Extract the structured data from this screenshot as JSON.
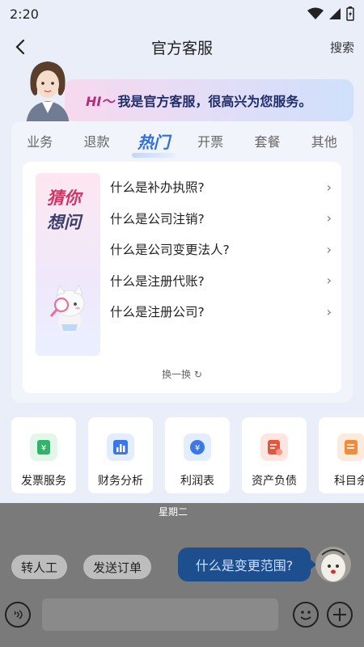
{
  "status": {
    "time": "2:20"
  },
  "nav": {
    "title": "官方客服",
    "search": "搜索"
  },
  "banner": {
    "hi": "HI～",
    "text": "我是官方客服，很高兴为您服务。"
  },
  "tabs": [
    "业务",
    "退款",
    "热门",
    "开票",
    "套餐",
    "其他"
  ],
  "active_tab": "热门",
  "guess": {
    "line1": "猜你",
    "line2": "想问"
  },
  "questions": [
    "什么是补办执照?",
    "什么是公司注销?",
    "什么是公司变更法人?",
    "什么是注册代账?",
    "什么是注册公司?"
  ],
  "refresh": "换一换 ↻",
  "tools": [
    {
      "label": "发票服务",
      "icon": "invoice-icon",
      "color": "#2fb56a"
    },
    {
      "label": "财务分析",
      "icon": "chart-icon",
      "color": "#3b78e7"
    },
    {
      "label": "利润表",
      "icon": "yen-icon",
      "color": "#3b78e7"
    },
    {
      "label": "资产负债",
      "icon": "ledger-icon",
      "color": "#e8543e"
    },
    {
      "label": "科目余",
      "icon": "subject-icon",
      "color": "#f08a3c"
    }
  ],
  "chat": {
    "weekday": "星期二",
    "quick": [
      "转人工",
      "发送订单"
    ],
    "message": "什么是变更范围?"
  }
}
